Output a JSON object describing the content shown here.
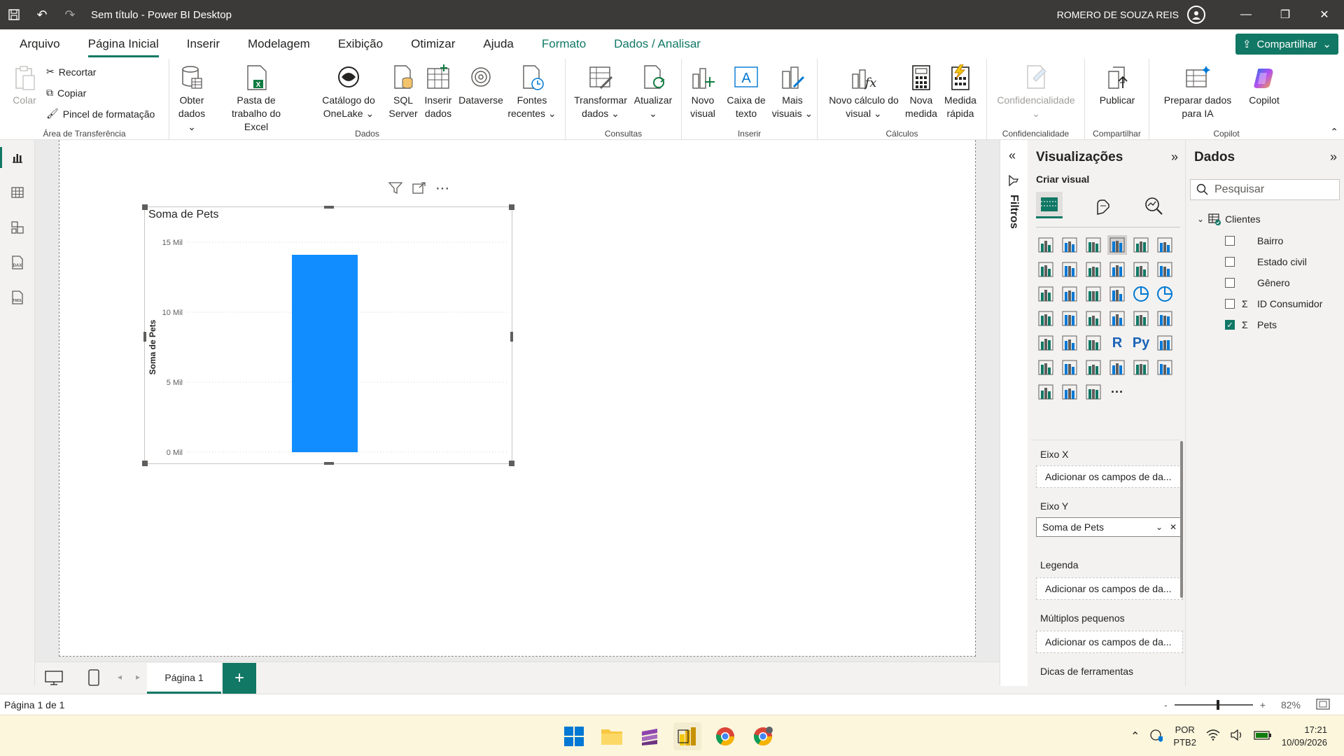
{
  "titlebar": {
    "title": "Sem título - Power BI Desktop",
    "user": "ROMERO DE SOUZA REIS"
  },
  "menu": {
    "tabs": [
      "Arquivo",
      "Página Inicial",
      "Inserir",
      "Modelagem",
      "Exibição",
      "Otimizar",
      "Ajuda",
      "Formato",
      "Dados / Analisar"
    ],
    "active": "Página Inicial",
    "share": "Compartilhar"
  },
  "ribbon": {
    "clipboard": {
      "paste": "Colar",
      "cut": "Recortar",
      "copy": "Copiar",
      "format_painter": "Pincel de formatação",
      "label": "Área de Transferência"
    },
    "data": {
      "get_data": "Obter dados",
      "excel": "Pasta de trabalho do Excel",
      "onelake": "Catálogo do OneLake",
      "sql": "SQL Server",
      "enter": "Inserir dados",
      "dataverse": "Dataverse",
      "recent": "Fontes recentes",
      "label": "Dados"
    },
    "queries": {
      "transform": "Transformar dados",
      "refresh": "Atualizar",
      "label": "Consultas"
    },
    "insert": {
      "new_visual": "Novo visual",
      "text_box": "Caixa de texto",
      "more": "Mais visuais",
      "label": "Inserir"
    },
    "calc": {
      "new_calc": "Novo cálculo do visual",
      "new_measure": "Nova medida",
      "quick_measure": "Medida rápida",
      "label": "Cálculos"
    },
    "sensitivity": {
      "btn": "Confidencialidade",
      "label": "Confidencialidade"
    },
    "share": {
      "publish": "Publicar",
      "label": "Compartilhar"
    },
    "copilot": {
      "prepare": "Preparar dados para IA",
      "copilot": "Copilot",
      "label": "Copilot"
    }
  },
  "visual": {
    "title": "Soma de Pets",
    "chart_data": {
      "type": "bar",
      "categories": [
        ""
      ],
      "series": [
        {
          "values": [
            14100
          ]
        }
      ],
      "title": "Soma de Pets",
      "xlabel": "",
      "ylabel": "Soma de Pets",
      "ylim": [
        0,
        15000
      ],
      "yticks": [
        "0 Mil",
        "5 Mil",
        "10 Mil",
        "15 Mil"
      ],
      "grid": true,
      "color": "#118DFF"
    }
  },
  "filters": {
    "label": "Filtros"
  },
  "viz_pane": {
    "title": "Visualizações",
    "sub": "Criar visual",
    "wells": [
      {
        "label": "Eixo X",
        "value": "Adicionar os campos de da..."
      },
      {
        "label": "Eixo Y",
        "value": "Soma de Pets"
      },
      {
        "label": "Legenda",
        "value": "Adicionar os campos de da..."
      },
      {
        "label": "Múltiplos pequenos",
        "value": "Adicionar os campos de da..."
      },
      {
        "label": "Dicas de ferramentas",
        "value": ""
      }
    ]
  },
  "data_pane": {
    "title": "Dados",
    "search_placeholder": "Pesquisar",
    "table": "Clientes",
    "fields": [
      {
        "name": "Bairro",
        "sigma": false,
        "checked": false
      },
      {
        "name": "Estado civil",
        "sigma": false,
        "checked": false
      },
      {
        "name": "Gênero",
        "sigma": false,
        "checked": false
      },
      {
        "name": "ID Consumidor",
        "sigma": true,
        "checked": false
      },
      {
        "name": "Pets",
        "sigma": true,
        "checked": true
      }
    ]
  },
  "page_tabs": {
    "tab": "Página 1",
    "add": "+"
  },
  "status": {
    "page": "Página 1 de 1",
    "zoom": "82%"
  },
  "taskbar": {
    "lang1": "POR",
    "lang2": "PTB2",
    "time": "17:21",
    "date": "10/09/2026"
  }
}
